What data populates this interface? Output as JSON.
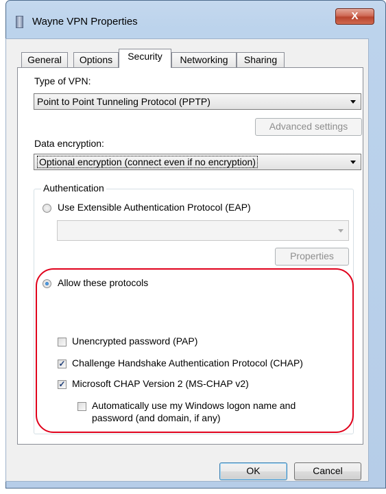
{
  "window": {
    "title": "Wayne VPN Properties",
    "close_glyph": "X"
  },
  "tabs": [
    {
      "label": "General",
      "active": false
    },
    {
      "label": "Options",
      "active": false
    },
    {
      "label": "Security",
      "active": true
    },
    {
      "label": "Networking",
      "active": false
    },
    {
      "label": "Sharing",
      "active": false
    }
  ],
  "security": {
    "vpn_type_label": "Type of VPN:",
    "vpn_type_value": "Point to Point Tunneling Protocol (PPTP)",
    "advanced_settings_label": "Advanced settings",
    "data_encryption_label": "Data encryption:",
    "data_encryption_value": "Optional encryption (connect even if no encryption)",
    "authentication": {
      "legend": "Authentication",
      "eap_radio_label": "Use Extensible Authentication Protocol (EAP)",
      "eap_radio_checked": false,
      "eap_combo_value": "",
      "properties_label": "Properties",
      "allow_radio_label": "Allow these protocols",
      "allow_radio_checked": true,
      "protocols": [
        {
          "label": "Unencrypted password (PAP)",
          "checked": false
        },
        {
          "label": "Challenge Handshake Authentication Protocol (CHAP)",
          "checked": true
        },
        {
          "label": "Microsoft CHAP Version 2 (MS-CHAP v2)",
          "checked": true
        }
      ],
      "auto_logon_line1": "Automatically use my Windows logon name and",
      "auto_logon_line2": "password (and domain, if any)",
      "auto_logon_checked": false
    }
  },
  "footer": {
    "ok_label": "OK",
    "cancel_label": "Cancel"
  },
  "annotation": {
    "highlight_color": "#e0001b"
  }
}
